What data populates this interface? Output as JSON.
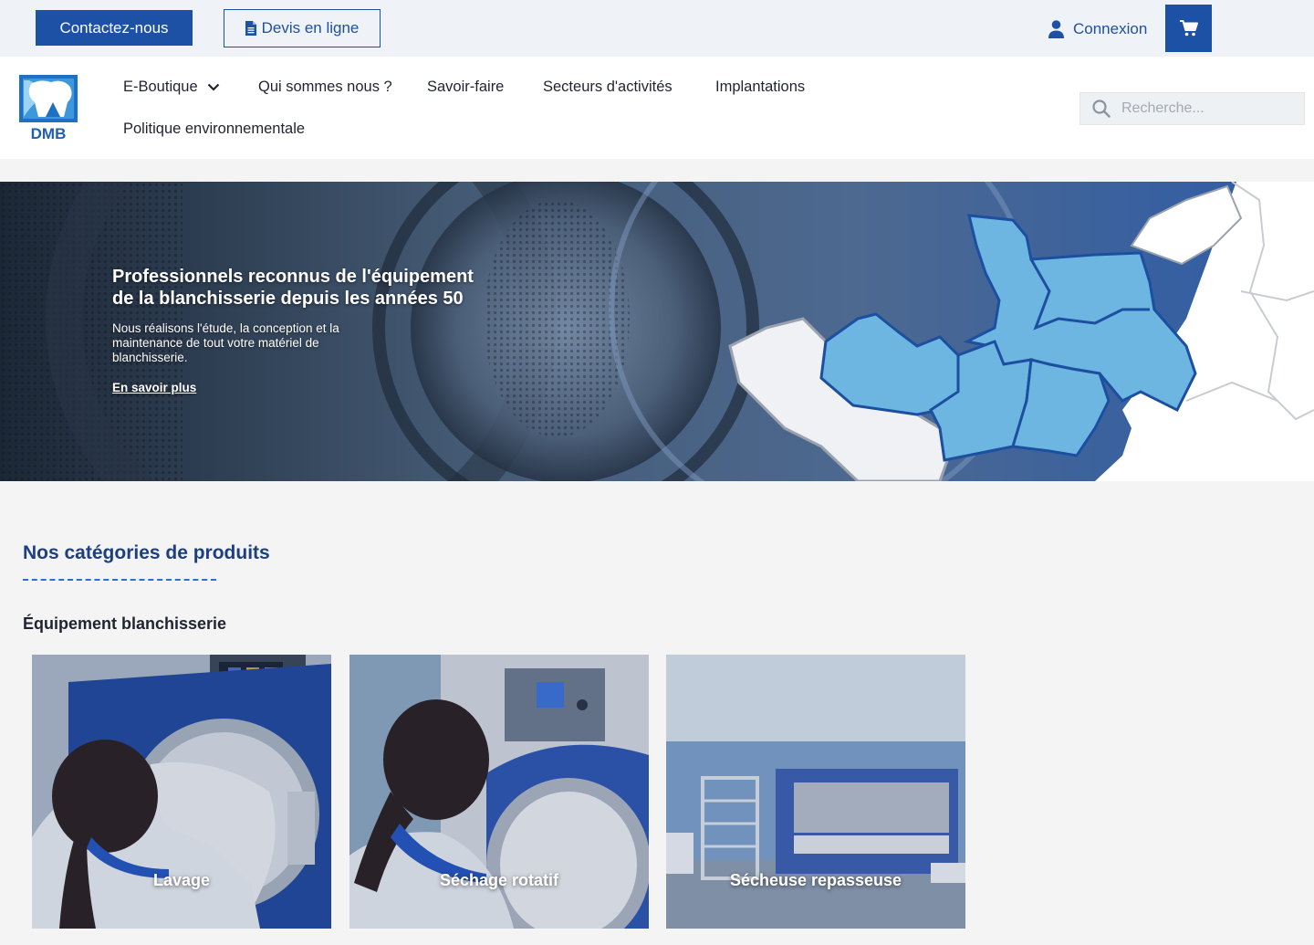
{
  "topbar": {
    "contact_label": "Contactez-nous",
    "devis_label": "Devis en ligne",
    "login_label": "Connexion"
  },
  "brand": {
    "logo_text": "DMB",
    "color_primary": "#1d51a5",
    "color_title": "#1c3f83",
    "color_map_highlight": "#6db6e2"
  },
  "nav": {
    "items": [
      {
        "label": "E-Boutique",
        "has_dropdown": true
      },
      {
        "label": "Qui sommes nous ?"
      },
      {
        "label": "Savoir-faire"
      },
      {
        "label": "Secteurs d'activités"
      },
      {
        "label": "Implantations"
      },
      {
        "label": "Politique environnementale"
      }
    ]
  },
  "search": {
    "placeholder": "Recherche..."
  },
  "hero": {
    "title": "Professionnels reconnus de l'équipement de la blanchisserie depuis les années 50",
    "text": "Nous réalisons l'étude, la conception et la maintenance de tout votre matériel de blanchisserie.",
    "link_label": "En savoir plus"
  },
  "categories": {
    "title": "Nos catégories de produits",
    "subsection_title": "Équipement blanchisserie",
    "cards": [
      {
        "label": "Lavage"
      },
      {
        "label": "Séchage rotatif"
      },
      {
        "label": "Sécheuse repasseuse"
      }
    ]
  },
  "icons": {
    "devis": "document-icon",
    "login": "user-icon",
    "cart": "cart-icon",
    "search": "search-icon",
    "dropdown": "chevron-down-icon"
  }
}
